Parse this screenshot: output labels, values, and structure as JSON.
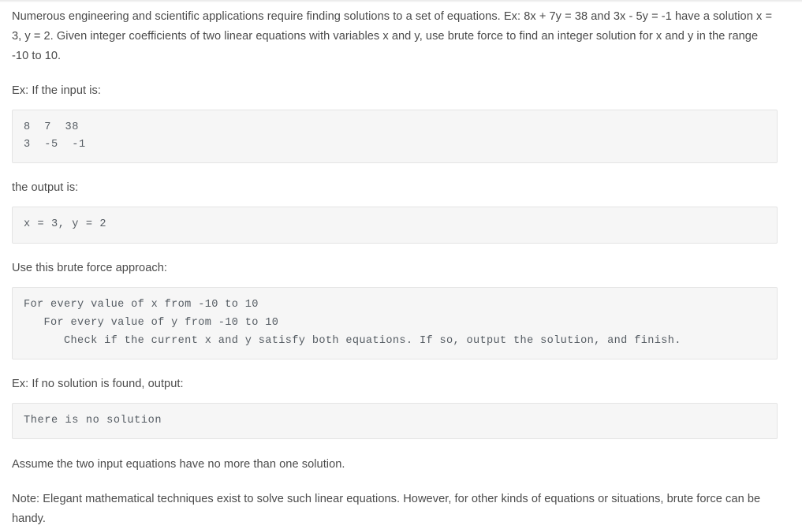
{
  "document": {
    "intro_paragraph": "Numerous engineering and scientific applications require finding solutions to a set of equations. Ex: 8x + 7y = 38 and 3x - 5y = -1 have a solution x = 3, y = 2. Given integer coefficients of two linear equations with variables x and y, use brute force to find an integer solution for x and y in the range -10 to 10.",
    "input_label": "Ex: If the input is:",
    "input_code": {
      "lines": [
        "8  7  38",
        "3  -5  -1"
      ],
      "line_0": "8  7  38",
      "line_1": "3  -5  -1"
    },
    "output_label": "the output is:",
    "output_code": {
      "line_0": "x = 3, y = 2"
    },
    "approach_label": "Use this brute force approach:",
    "pseudocode": {
      "line_0": "For every value of x from -10 to 10",
      "line_1": "   For every value of y from -10 to 10",
      "line_2": "      Check if the current x and y satisfy both equations. If so, output the solution, and finish."
    },
    "no_solution_label": "Ex: If no solution is found, output:",
    "no_solution_code": {
      "line_0": "There is no solution"
    },
    "assume_paragraph": "Assume the two input equations have no more than one solution.",
    "note_paragraph": "Note: Elegant mathematical techniques exist to solve such linear equations. However, for other kinds of equations or situations, brute force can be handy."
  },
  "colors": {
    "body_text": "#4b4b4b",
    "code_text": "#555c63",
    "code_background": "#f6f6f6",
    "code_border": "#e4e4e4",
    "page_background": "#ffffff"
  }
}
